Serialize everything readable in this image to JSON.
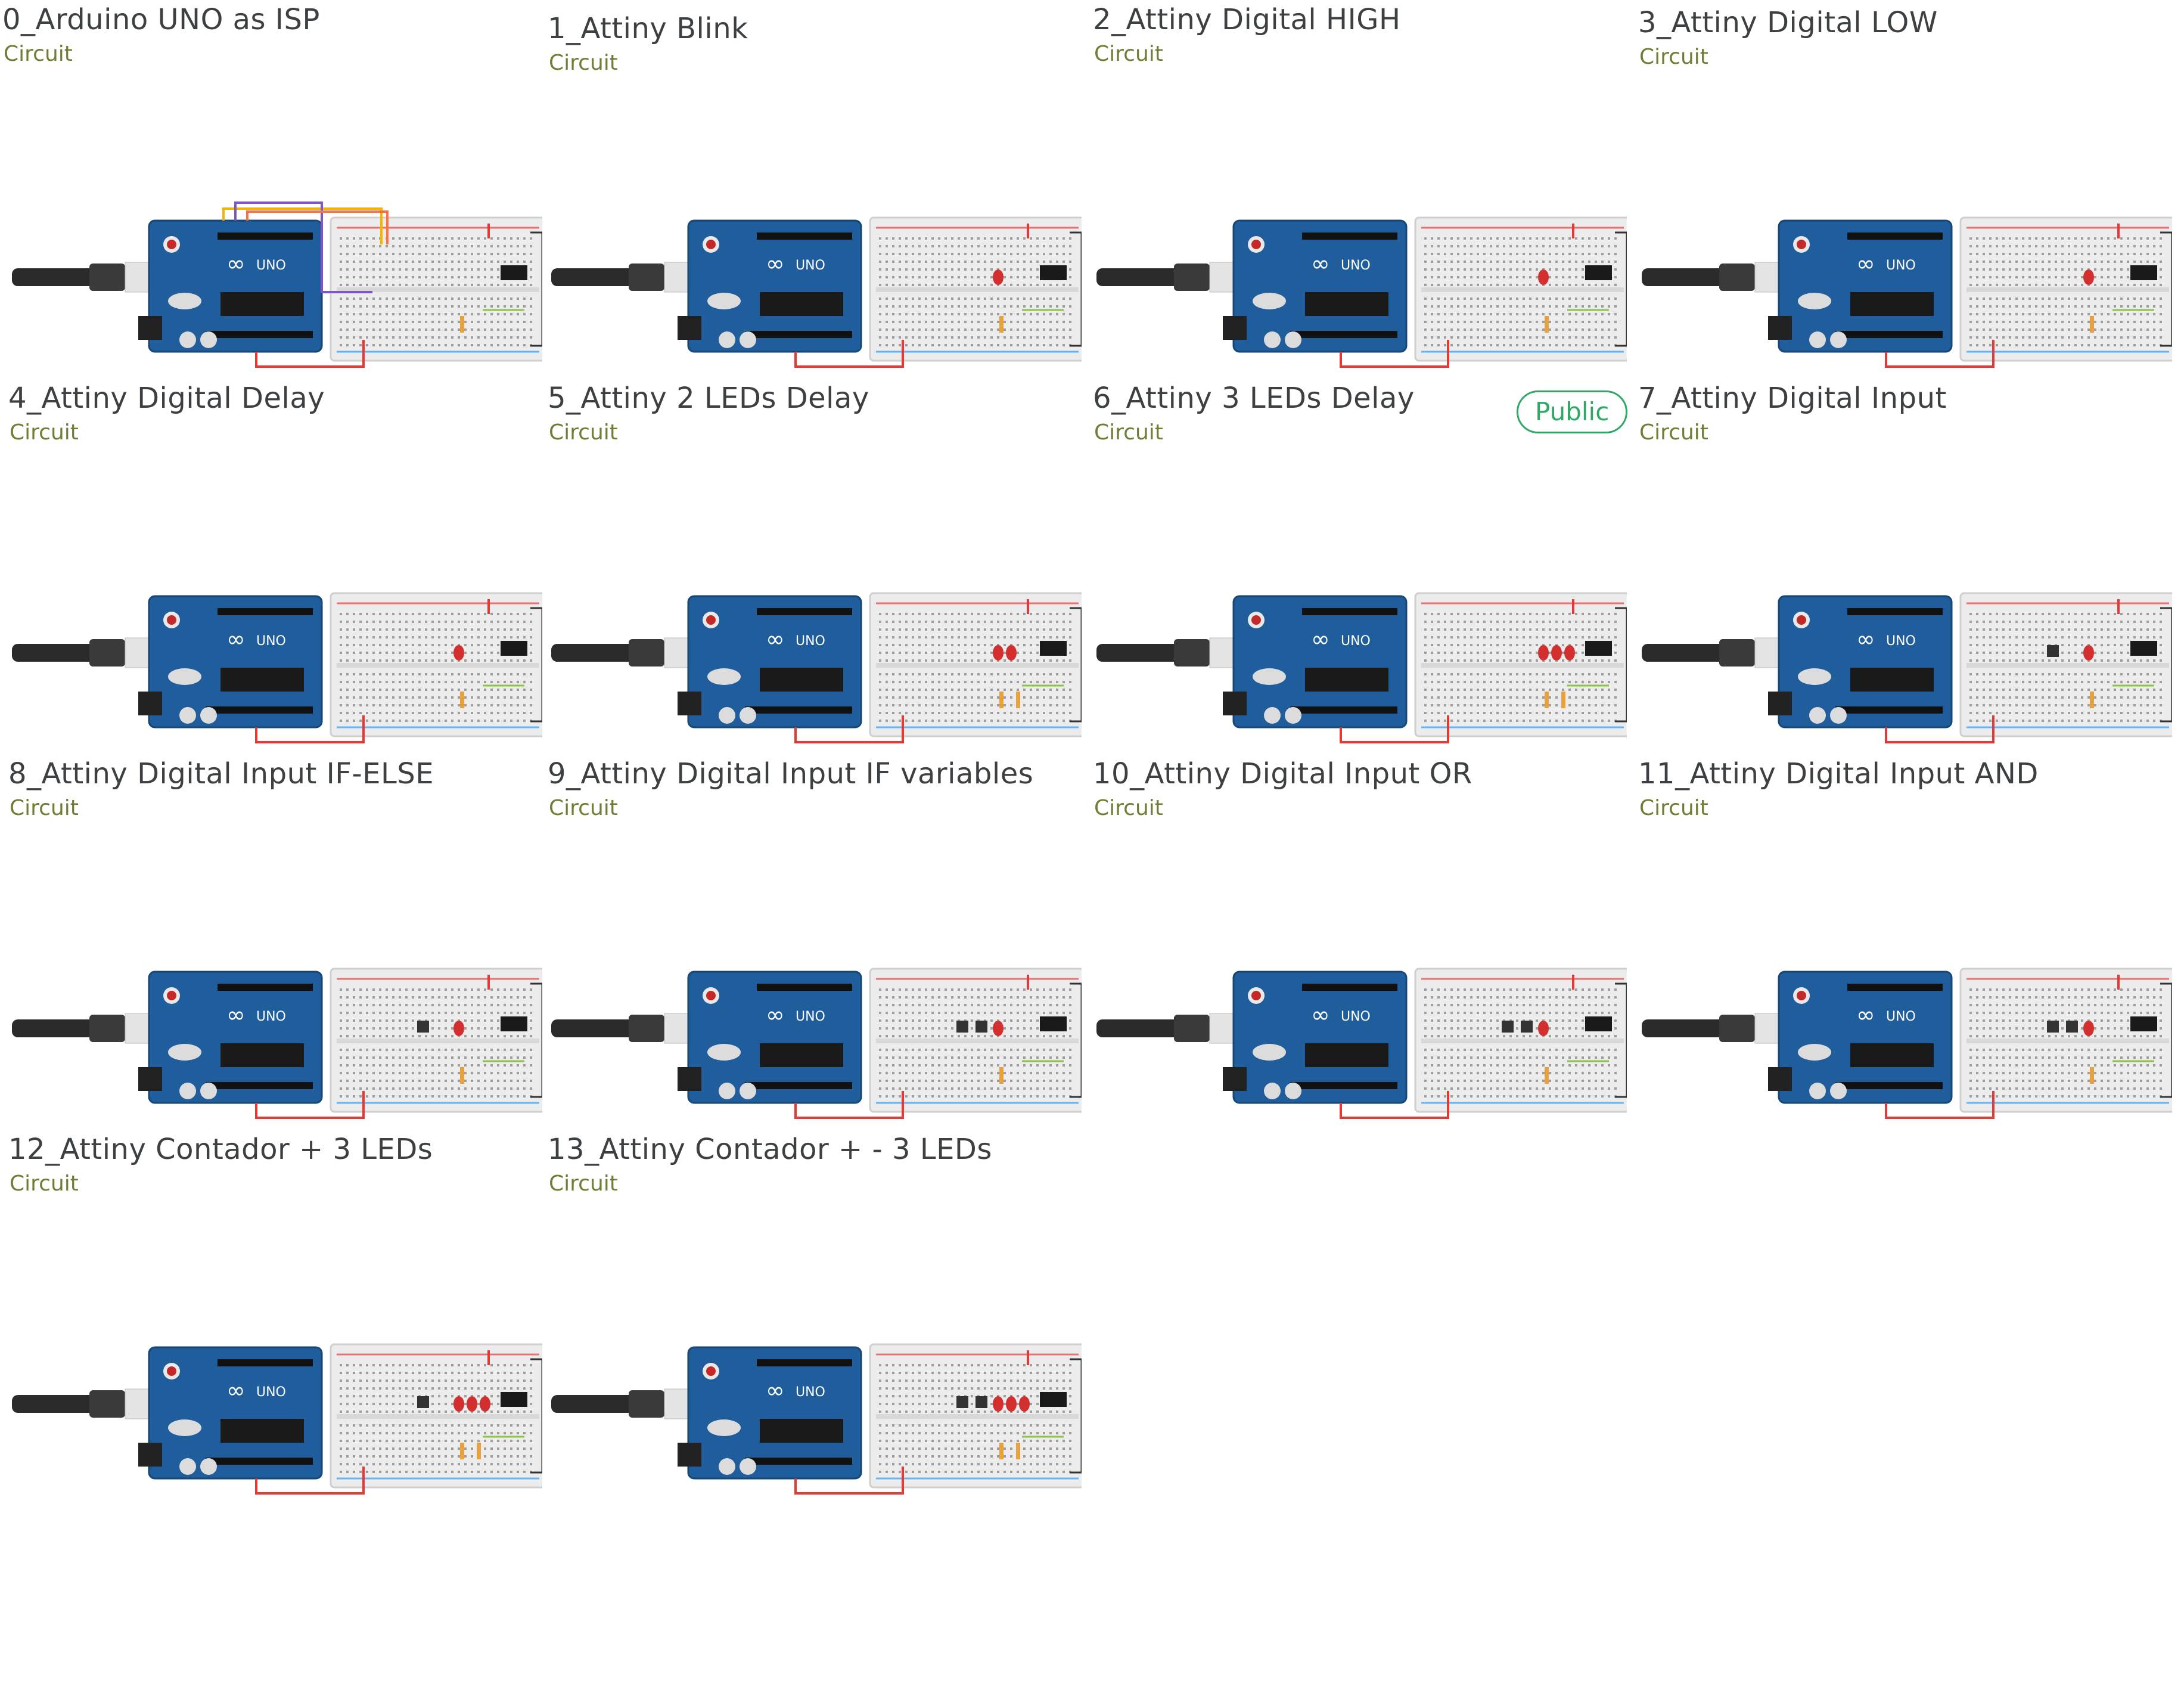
{
  "colors": {
    "title": "#3c4043",
    "type_label": "#6d7f35",
    "badge": "#2ea866",
    "arduino_board": "#1f5d9c",
    "breadboard": "#ececec",
    "wire_red": "#e53935"
  },
  "top_row": [
    {
      "title": "0_Arduino UNO as ISP",
      "type": "Circuit"
    },
    {
      "title": "1_Attiny Blink",
      "type": "Circuit"
    },
    {
      "title": "2_Attiny Digital HIGH",
      "type": "Circuit"
    },
    {
      "title": "3_Attiny Digital LOW",
      "type": "Circuit"
    }
  ],
  "projects": [
    {
      "title": "4_Attiny Digital Delay",
      "type": "Circuit",
      "leds": 0,
      "buttons": 0,
      "wires": "isp"
    },
    {
      "title": "5_Attiny 2 LEDs Delay",
      "type": "Circuit",
      "leds": 1,
      "buttons": 0
    },
    {
      "title": "6_Attiny 3 LEDs Delay",
      "type": "Circuit",
      "leds": 1,
      "buttons": 0,
      "badge": "Public"
    },
    {
      "title": "7_Attiny Digital Input",
      "type": "Circuit",
      "leds": 1,
      "buttons": 0
    },
    {
      "title": "8_Attiny Digital Input IF-ELSE",
      "type": "Circuit",
      "leds": 1,
      "buttons": 0
    },
    {
      "title": "9_Attiny Digital Input IF variables",
      "type": "Circuit",
      "leds": 2,
      "buttons": 0
    },
    {
      "title": "10_Attiny Digital Input OR",
      "type": "Circuit",
      "leds": 3,
      "buttons": 0
    },
    {
      "title": "11_Attiny Digital Input AND",
      "type": "Circuit",
      "leds": 1,
      "buttons": 1
    },
    {
      "title": "12_Attiny Contador + 3 LEDs",
      "type": "Circuit",
      "leds": 1,
      "buttons": 1
    },
    {
      "title": "13_Attiny Contador + - 3 LEDs",
      "type": "Circuit",
      "leds": 1,
      "buttons": 2
    },
    {
      "title": "",
      "type": "",
      "leds": 1,
      "buttons": 2
    },
    {
      "title": "",
      "type": "",
      "leds": 1,
      "buttons": 2
    },
    {
      "title": "",
      "type": "",
      "leds": 3,
      "buttons": 1
    },
    {
      "title": "",
      "type": "",
      "leds": 3,
      "buttons": 2
    }
  ]
}
